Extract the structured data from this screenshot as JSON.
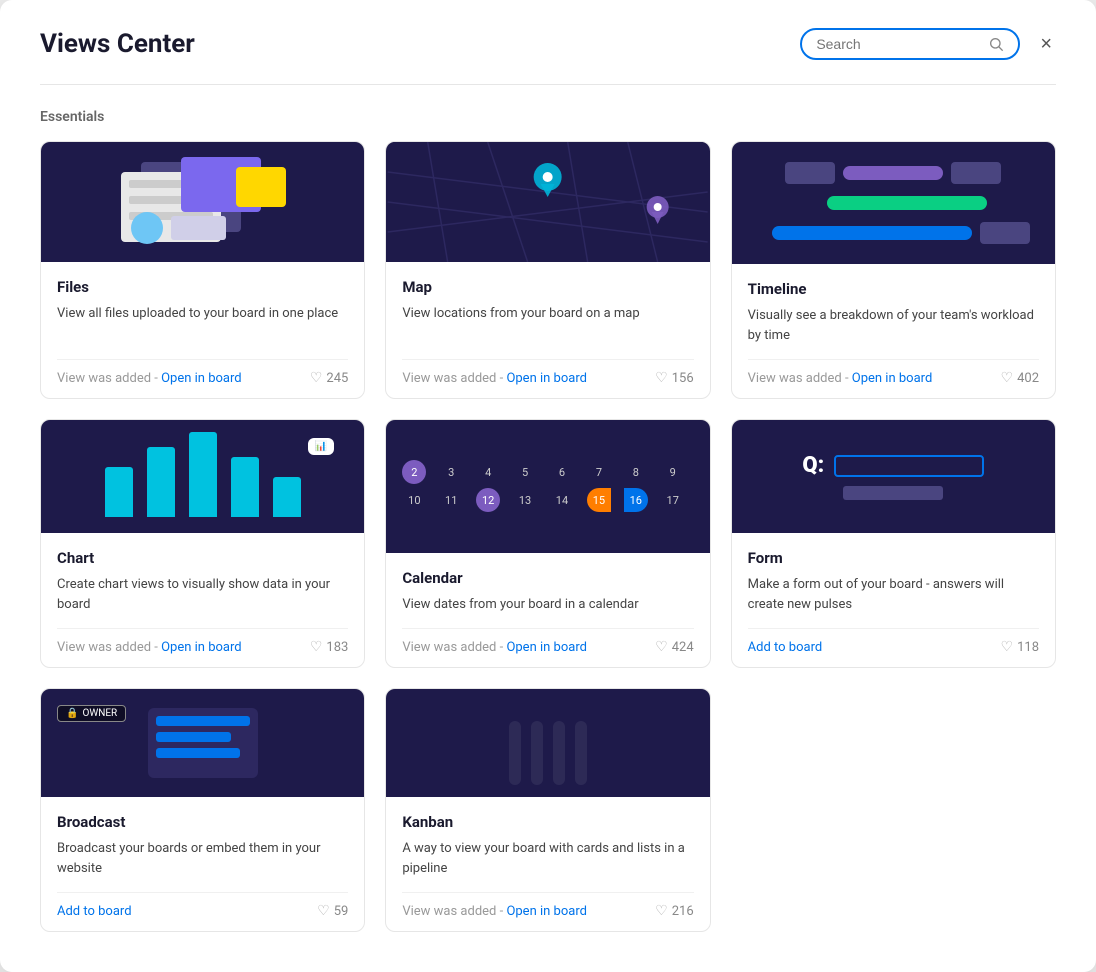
{
  "modal": {
    "title": "Views Center",
    "close_label": "×"
  },
  "search": {
    "placeholder": "Search"
  },
  "sections": [
    {
      "label": "Essentials",
      "cards": [
        {
          "id": "files",
          "title": "Files",
          "description": "View all files uploaded to your board in one place",
          "status": "View was added",
          "action_label": "Open in board",
          "likes": 245,
          "type": "added"
        },
        {
          "id": "map",
          "title": "Map",
          "description": "View locations from your board on a map",
          "status": "View was added",
          "action_label": "Open in board",
          "likes": 156,
          "type": "added"
        },
        {
          "id": "timeline",
          "title": "Timeline",
          "description": "Visually see a breakdown of your team's workload by time",
          "status": "View was added",
          "action_label": "Open in board",
          "likes": 402,
          "type": "added"
        },
        {
          "id": "chart",
          "title": "Chart",
          "description": "Create chart views to visually show data in your board",
          "status": "View was added",
          "action_label": "Open in board",
          "likes": 183,
          "type": "added"
        },
        {
          "id": "calendar",
          "title": "Calendar",
          "description": "View dates from your board in a calendar",
          "status": "View was added",
          "action_label": "Open in board",
          "likes": 424,
          "type": "added"
        },
        {
          "id": "form",
          "title": "Form",
          "description": "Make a form out of your board - answers will create new pulses",
          "status": "",
          "action_label": "Add to board",
          "likes": 118,
          "type": "add"
        },
        {
          "id": "broadcast",
          "title": "Broadcast",
          "description": "Broadcast your boards or embed them in your website",
          "status": "",
          "action_label": "Add to board",
          "likes": 59,
          "type": "add"
        },
        {
          "id": "kanban",
          "title": "Kanban",
          "description": "A way to view your board with cards and lists in a pipeline",
          "status": "View was added",
          "action_label": "Open in board",
          "likes": 216,
          "type": "added"
        }
      ]
    }
  ],
  "kanban_colors": [
    "#0acf83",
    "#ffd700",
    "#ff5c5c",
    "#ccc"
  ],
  "status_text": "View was added - "
}
